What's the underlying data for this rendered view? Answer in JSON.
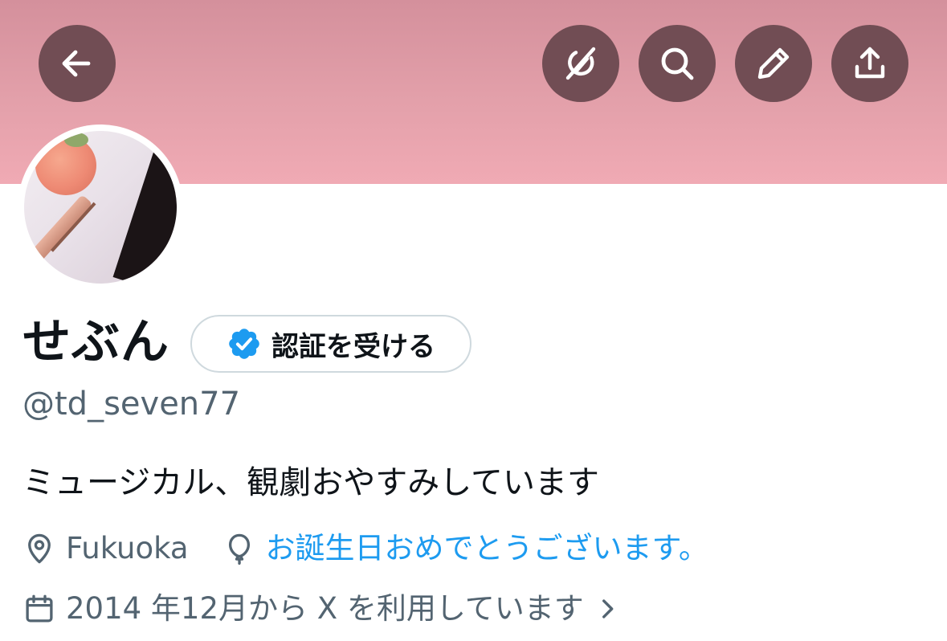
{
  "header": {
    "back_icon": "arrow-left-icon",
    "actions": [
      "grok-icon",
      "search-icon",
      "edit-icon",
      "share-icon"
    ],
    "banner_color": "#e3a0aa",
    "button_color": "#714d54"
  },
  "profile": {
    "display_name": "せぶん",
    "verify_label": "認証を受ける",
    "verify_badge_color": "#1d9bf0",
    "handle": "@td_seven77",
    "bio": "ミュージカル、観劇おやすみしています",
    "location": "Fukuoka",
    "birthday_message": "お誕生日おめでとうございます。",
    "joined": "2014 年12月から X を利用しています",
    "link_color": "#1d9bf0"
  }
}
